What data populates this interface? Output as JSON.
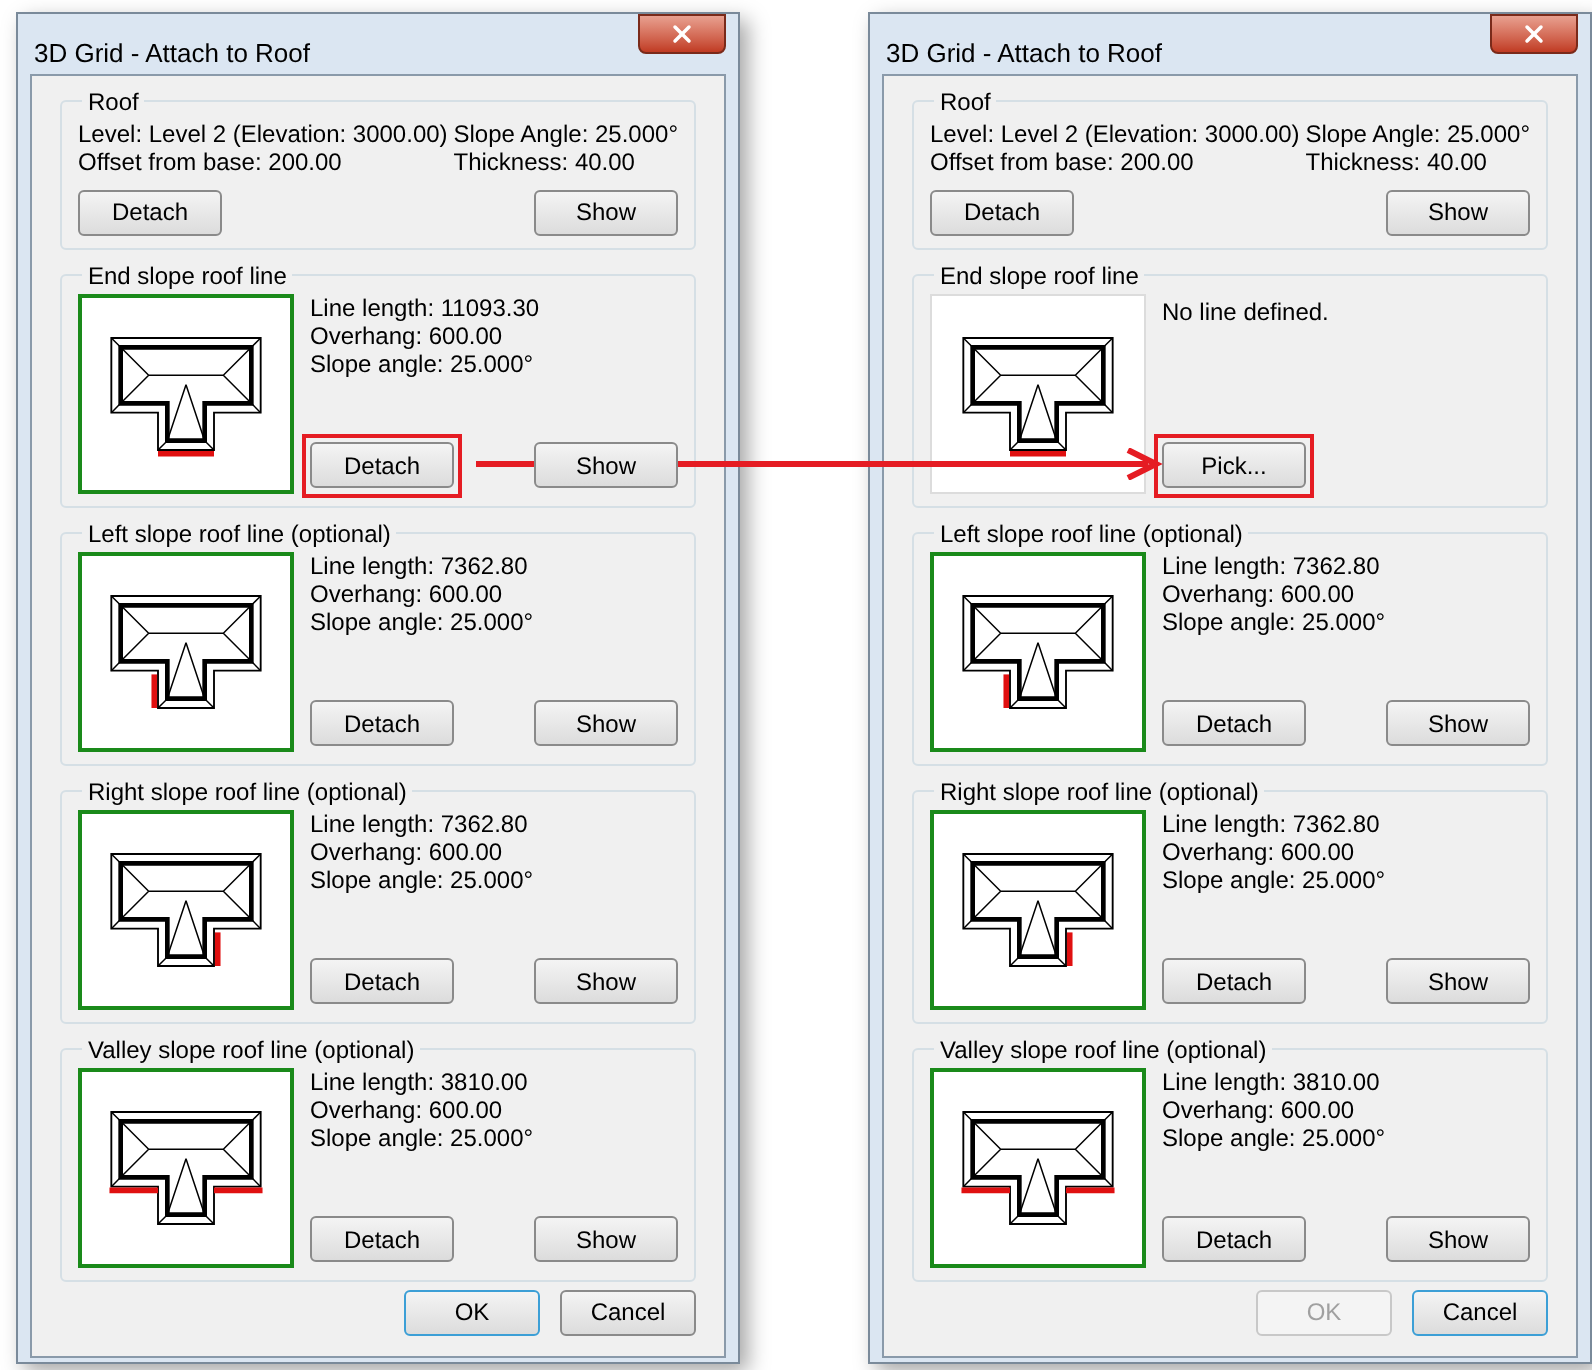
{
  "dialogs": [
    {
      "title": "3D Grid - Attach to Roof",
      "roof": {
        "label": "Roof",
        "level": "Level: Level 2  (Elevation: 3000.00)",
        "offset": "Offset from base: 200.00",
        "slope": "Slope Angle: 25.000°",
        "thickness": "Thickness: 40.00",
        "buttons": [
          {
            "label": "Detach"
          },
          {
            "label": "Show"
          }
        ]
      },
      "lines": [
        {
          "label": "End slope roof line",
          "defined": true,
          "kind": "bottom",
          "info": [
            "Line length: 11093.30",
            "Overhang: 600.00",
            "Slope angle: 25.000°"
          ],
          "buttons": [
            {
              "label": "Detach",
              "callout": true
            },
            {
              "label": "Show",
              "callout": false
            }
          ]
        },
        {
          "label": "Left slope roof line (optional)",
          "defined": true,
          "kind": "left",
          "info": [
            "Line length: 7362.80",
            "Overhang: 600.00",
            "Slope angle: 25.000°"
          ],
          "buttons": [
            {
              "label": "Detach",
              "callout": false
            },
            {
              "label": "Show",
              "callout": false
            }
          ]
        },
        {
          "label": "Right slope roof line (optional)",
          "defined": true,
          "kind": "right",
          "info": [
            "Line length: 7362.80",
            "Overhang: 600.00",
            "Slope angle: 25.000°"
          ],
          "buttons": [
            {
              "label": "Detach",
              "callout": false
            },
            {
              "label": "Show",
              "callout": false
            }
          ]
        },
        {
          "label": "Valley slope roof line (optional)",
          "defined": true,
          "kind": "valley",
          "info": [
            "Line length: 3810.00",
            "Overhang: 600.00",
            "Slope angle: 25.000°"
          ],
          "buttons": [
            {
              "label": "Detach",
              "callout": false
            },
            {
              "label": "Show",
              "callout": false
            }
          ]
        }
      ],
      "footer": [
        {
          "label": "OK",
          "default": true,
          "disabled": false
        },
        {
          "label": "Cancel",
          "default": false,
          "disabled": false
        }
      ]
    },
    {
      "title": "3D Grid - Attach to Roof",
      "roof": {
        "label": "Roof",
        "level": "Level: Level 2  (Elevation: 3000.00)",
        "offset": "Offset from base: 200.00",
        "slope": "Slope Angle: 25.000°",
        "thickness": "Thickness: 40.00",
        "buttons": [
          {
            "label": "Detach"
          },
          {
            "label": "Show"
          }
        ]
      },
      "lines": [
        {
          "label": "End slope roof line",
          "defined": false,
          "kind": "bottom",
          "info": [
            "No line defined."
          ],
          "buttons": [
            {
              "label": "Pick...",
              "callout": true
            }
          ]
        },
        {
          "label": "Left slope roof line (optional)",
          "defined": true,
          "kind": "left",
          "info": [
            "Line length: 7362.80",
            "Overhang: 600.00",
            "Slope angle: 25.000°"
          ],
          "buttons": [
            {
              "label": "Detach",
              "callout": false
            },
            {
              "label": "Show",
              "callout": false
            }
          ]
        },
        {
          "label": "Right slope roof line (optional)",
          "defined": true,
          "kind": "right",
          "info": [
            "Line length: 7362.80",
            "Overhang: 600.00",
            "Slope angle: 25.000°"
          ],
          "buttons": [
            {
              "label": "Detach",
              "callout": false
            },
            {
              "label": "Show",
              "callout": false
            }
          ]
        },
        {
          "label": "Valley slope roof line (optional)",
          "defined": true,
          "kind": "valley",
          "info": [
            "Line length: 3810.00",
            "Overhang: 600.00",
            "Slope angle: 25.000°"
          ],
          "buttons": [
            {
              "label": "Detach",
              "callout": false
            },
            {
              "label": "Show",
              "callout": false
            }
          ]
        }
      ],
      "footer": [
        {
          "label": "OK",
          "default": false,
          "disabled": true
        },
        {
          "label": "Cancel",
          "default": true,
          "disabled": false
        }
      ]
    }
  ]
}
